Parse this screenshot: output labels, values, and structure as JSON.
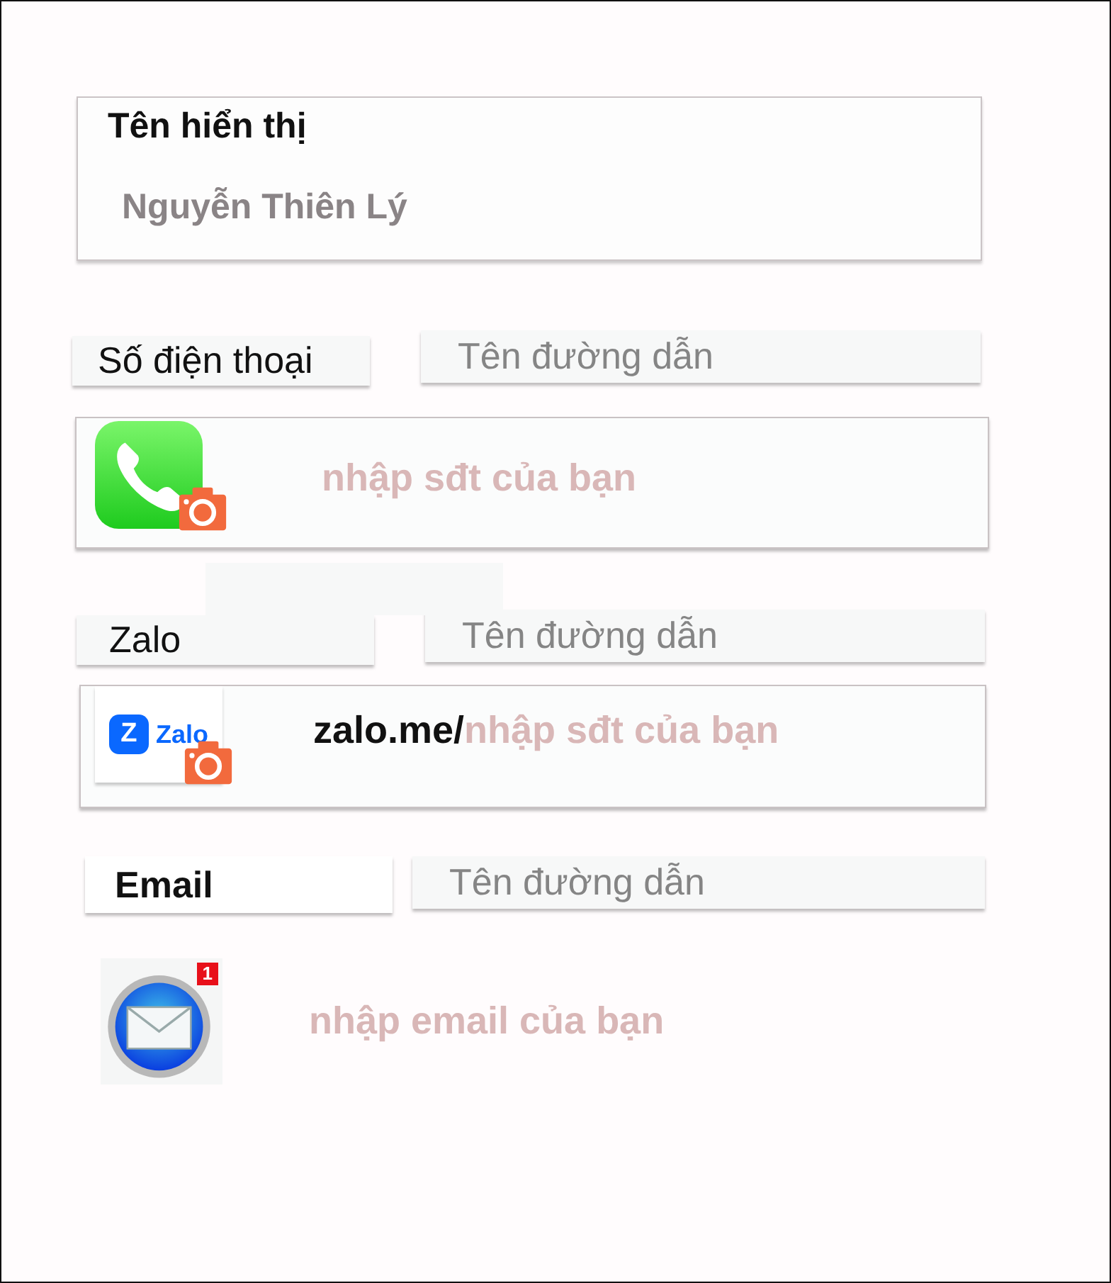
{
  "display_name": {
    "title": "Tên hiển thị",
    "value": "Nguyễn Thiên Lý"
  },
  "contacts": [
    {
      "kind": "phone",
      "label": "Số điện thoại",
      "label_bold": false,
      "link_name": {
        "placeholder": "Tên đường dẫn"
      },
      "entry": {
        "placeholder": "nhập sđt của bạn"
      }
    },
    {
      "kind": "zalo",
      "label": "Zalo",
      "label_bold": false,
      "link_name": {
        "placeholder": "Tên đường dẫn"
      },
      "logo_mark": "Z",
      "logo_text": "Zalo",
      "entry": {
        "prefix": "zalo.me/",
        "placeholder": "nhập sđt của bạn"
      }
    },
    {
      "kind": "email",
      "label": "Email",
      "label_bold": true,
      "link_name": {
        "placeholder": "Tên đường dẫn"
      },
      "badge": "1",
      "entry": {
        "placeholder": "nhập email của bạn"
      }
    }
  ]
}
